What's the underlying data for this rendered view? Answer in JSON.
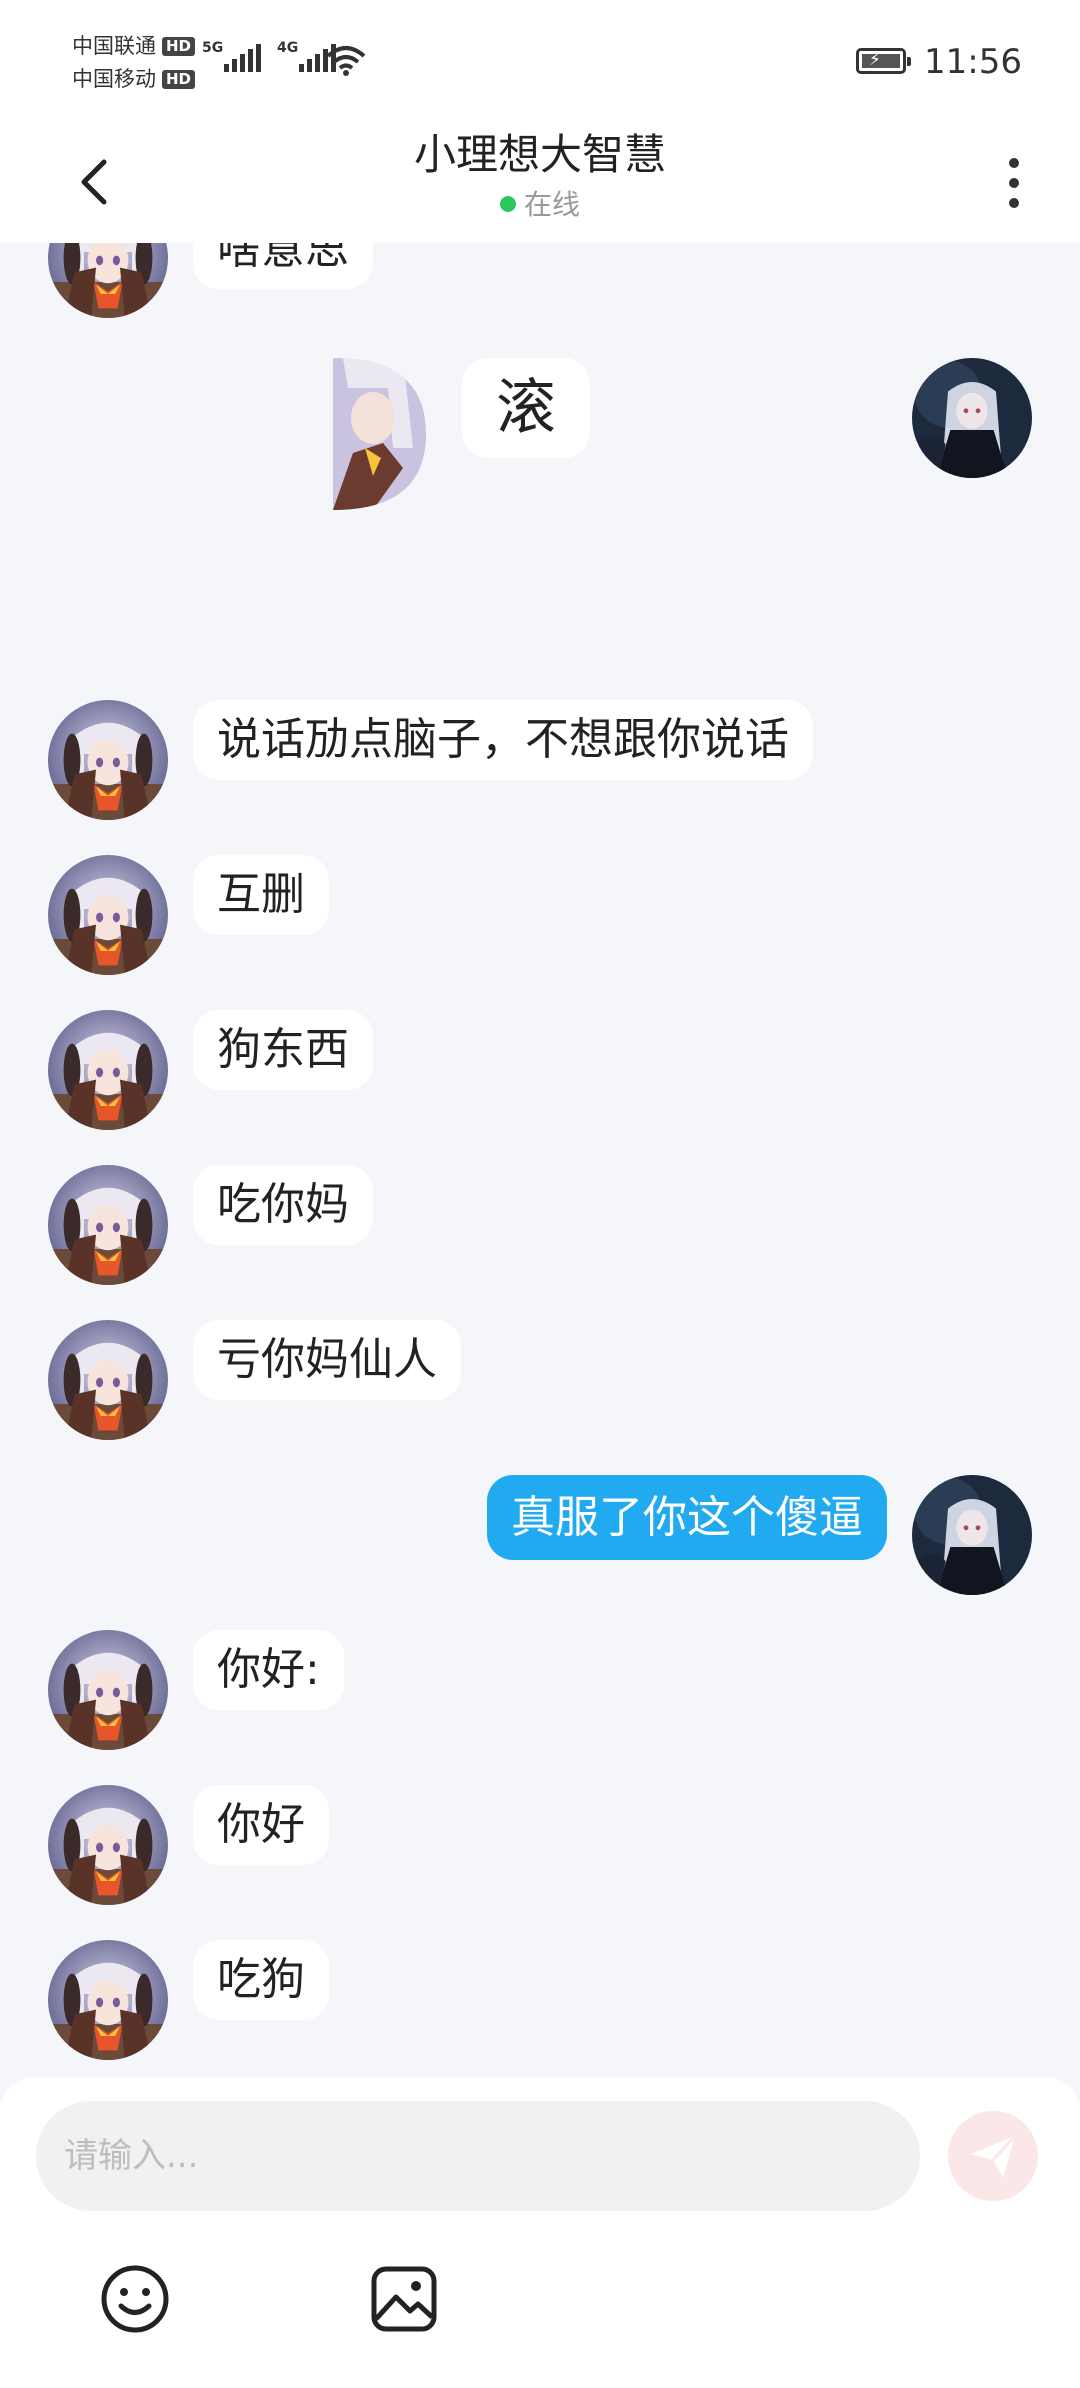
{
  "status_bar": {
    "carrier_1": "中国联通",
    "carrier_2": "中国移动",
    "hd_badge": "HD",
    "network_1": "5G",
    "network_2": "4G",
    "time": "11:56"
  },
  "header": {
    "title": "小理想大智慧",
    "presence": "在线",
    "back_icon": "chevron-left-icon",
    "menu_icon": "more-vertical-icon"
  },
  "messages": [
    {
      "side": "in",
      "text": "啥意思"
    },
    {
      "side": "in",
      "type": "image"
    },
    {
      "side": "out",
      "text": "滚"
    },
    {
      "side": "in",
      "text": "说话劢点脑子，不想跟你说话"
    },
    {
      "side": "in",
      "text": "互删"
    },
    {
      "side": "in",
      "text": "狗东西"
    },
    {
      "side": "in",
      "text": "吃你妈"
    },
    {
      "side": "in",
      "text": "亏你妈仙人"
    },
    {
      "side": "out",
      "text": "真服了你这个傻逼"
    },
    {
      "side": "in",
      "text": "你好:"
    },
    {
      "side": "in",
      "text": "你好"
    },
    {
      "side": "in",
      "text": "吃狗"
    }
  ],
  "input": {
    "placeholder": "请输入...",
    "send_icon": "paper-plane-icon"
  },
  "toolbar": {
    "emoji_icon": "smiley-icon",
    "image_icon": "image-icon"
  },
  "colors": {
    "accent": "#22aaf0",
    "online": "#2fc561",
    "background": "#f4f6f9",
    "send_button": "#fbe7e7"
  }
}
